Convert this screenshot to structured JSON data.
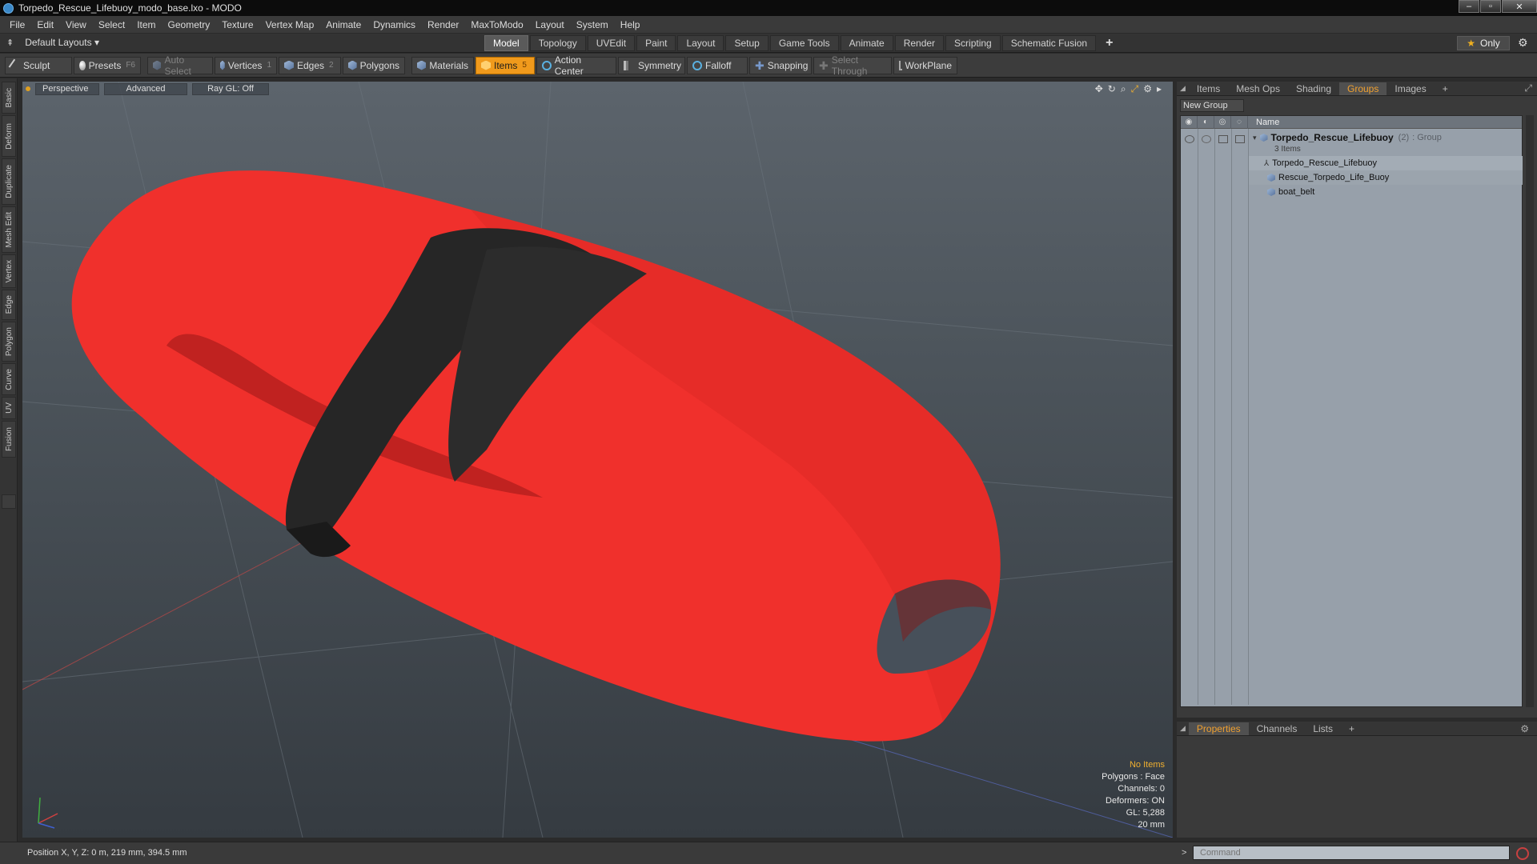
{
  "window": {
    "title": "Torpedo_Rescue_Lifebuoy_modo_base.lxo - MODO",
    "controls": [
      "–",
      "▫",
      "✕"
    ]
  },
  "menu": [
    "File",
    "Edit",
    "View",
    "Select",
    "Item",
    "Geometry",
    "Texture",
    "Vertex Map",
    "Animate",
    "Dynamics",
    "Render",
    "MaxToModo",
    "Layout",
    "System",
    "Help"
  ],
  "layout_bar": {
    "layouts_label": "Default Layouts ▾",
    "tabs": [
      "Model",
      "Topology",
      "UVEdit",
      "Paint",
      "Layout",
      "Setup",
      "Game Tools",
      "Animate",
      "Render",
      "Scripting",
      "Schematic Fusion"
    ],
    "active_tab": "Model",
    "only_label": "Only"
  },
  "toolbar": {
    "sculpt": "Sculpt",
    "presets": "Presets",
    "presets_key": "F6",
    "auto_select": "Auto Select",
    "vertices": "Vertices",
    "vertices_count": "1",
    "edges": "Edges",
    "edges_count": "2",
    "polygons": "Polygons",
    "materials": "Materials",
    "items": "Items",
    "items_count": "5",
    "action_center": "Action Center",
    "symmetry": "Symmetry",
    "falloff": "Falloff",
    "snapping": "Snapping",
    "select_through": "Select Through",
    "workplane": "WorkPlane"
  },
  "left_tabs": [
    "Basic",
    "Deform",
    "Duplicate",
    "Mesh Edit",
    "Vertex",
    "Edge",
    "Polygon",
    "Curve",
    "UV",
    "Fusion"
  ],
  "viewport": {
    "view": "Perspective",
    "mode": "Advanced",
    "raygl": "Ray GL: Off",
    "info": {
      "no_items": "No Items",
      "polygons": "Polygons : Face",
      "channels": "Channels: 0",
      "deformers": "Deformers: ON",
      "gl": "GL: 5,288",
      "scale": "20 mm"
    },
    "colors": {
      "lifebuoy": "#f0302c",
      "belt": "#262626"
    }
  },
  "right_panel": {
    "tabs": [
      "Items",
      "Mesh Ops",
      "Shading",
      "Groups",
      "Images",
      "+"
    ],
    "active_tab": "Groups",
    "new_group": "New Group",
    "column_name": "Name",
    "group": {
      "name": "Torpedo_Rescue_Lifebuoy",
      "count": "(2)",
      "type": ": Group",
      "sub": "3 Items"
    },
    "items": [
      "Torpedo_Rescue_Lifebuoy",
      "Rescue_Torpedo_Life_Buoy",
      "boat_belt"
    ]
  },
  "properties_panel": {
    "tabs": [
      "Properties",
      "Channels",
      "Lists",
      "+"
    ],
    "active_tab": "Properties"
  },
  "status": {
    "position": "Position X, Y, Z:  0 m, 219 mm, 394.5 mm",
    "command_prompt": ">",
    "command_placeholder": "Command"
  }
}
